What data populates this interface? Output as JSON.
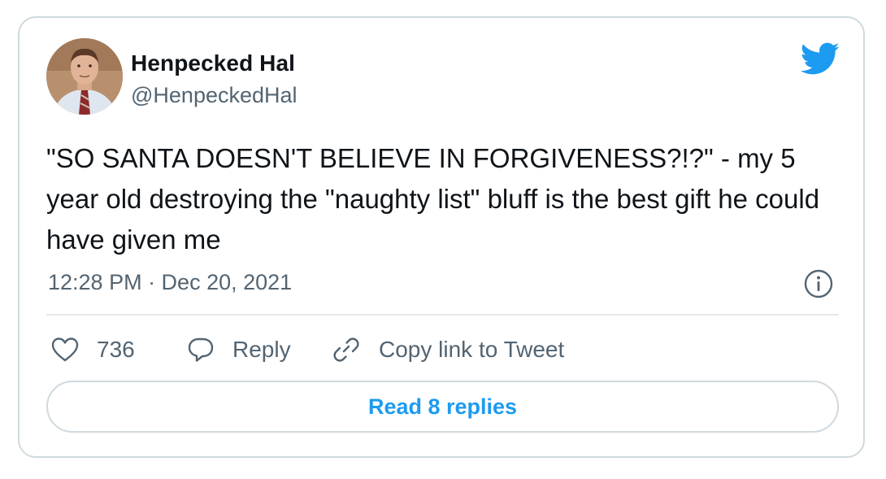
{
  "author": {
    "display_name": "Henpecked Hal",
    "handle": "@HenpeckedHal"
  },
  "tweet": {
    "text": "\"SO SANTA DOESN'T BELIEVE IN FORGIVENESS?!?\" - my 5 year old destroying the \"naughty list\" bluff is the best gift he could have given me",
    "timestamp": "12:28 PM · Dec 20, 2021"
  },
  "actions": {
    "like_count": "736",
    "reply_label": "Reply",
    "copy_link_label": "Copy link to Tweet"
  },
  "read_replies_label": "Read 8 replies",
  "icons": {
    "brand": "twitter-bird-icon",
    "info": "info-icon",
    "like": "heart-icon",
    "reply": "speech-bubble-icon",
    "copy": "link-icon"
  },
  "colors": {
    "brand_blue": "#1d9bf0",
    "text_primary": "#0f1419",
    "text_secondary": "#536471",
    "border": "#cfd9de"
  }
}
